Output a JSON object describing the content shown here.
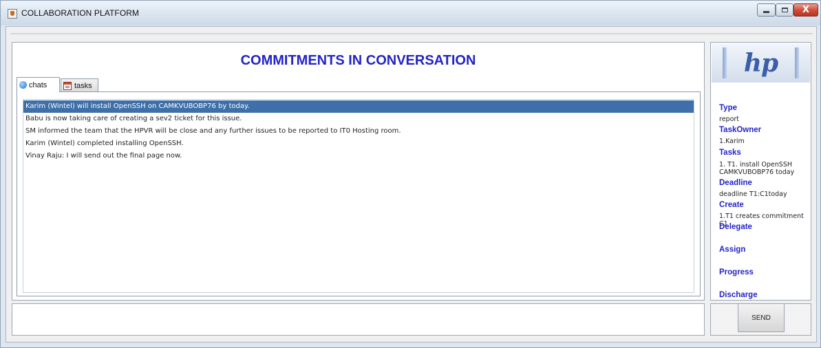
{
  "window": {
    "title": "COLLABORATION PLATFORM",
    "controls": {
      "minimize": "",
      "maximize": "",
      "close": "X"
    }
  },
  "main": {
    "heading": "COMMITMENTS IN CONVERSATION",
    "tabs": [
      {
        "label": "chats",
        "icon": "chat-bubble-icon",
        "selected": true
      },
      {
        "label": "tasks",
        "icon": "calendar-icon",
        "selected": false
      }
    ],
    "messages": [
      {
        "text": "Karim (Wintel) will install OpenSSH on CAMKVUBOBP76 by today.",
        "selected": true
      },
      {
        "text": "Babu is now taking care of creating a sev2 ticket for this issue.",
        "selected": false
      },
      {
        "text": "SM informed the team that the HPVR will be close and any further issues to be reported to IT0 Hosting room.",
        "selected": false
      },
      {
        "text": "Karim (Wintel) completed installing OpenSSH.",
        "selected": false
      },
      {
        "text": "Vinay Raju: I will send out the final page now.",
        "selected": false
      }
    ],
    "input_value": ""
  },
  "side": {
    "logo_text": "hp",
    "type_label": "Type",
    "type_value": "report",
    "taskowner_label": "TaskOwner",
    "taskowner_value": "1.Karim",
    "tasks_label": "Tasks",
    "tasks_value": "1. T1. install OpenSSH CAMKVUBOBP76 today",
    "deadline_label": "Deadline",
    "deadline_value": "deadline T1:C1today",
    "create_label": "Create",
    "create_value": "1.T1 creates commitment C1",
    "delegate_label": "Delegate",
    "assign_label": "Assign",
    "progress_label": "Progress",
    "discharge_label": "Discharge"
  },
  "send": {
    "label": "SEND"
  },
  "colors": {
    "heading": "#2323c8",
    "selection": "#3e6fa8",
    "close_button": "#c94a32"
  }
}
